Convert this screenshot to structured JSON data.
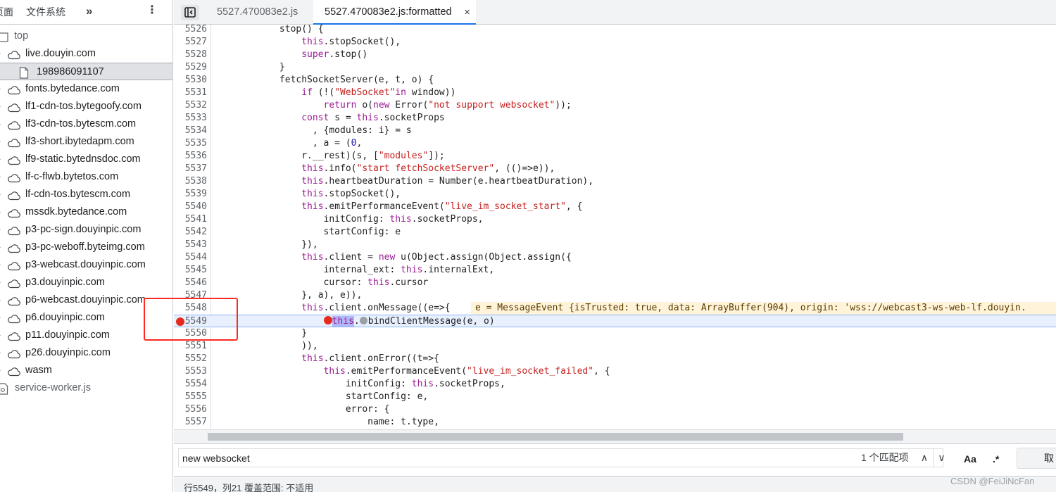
{
  "left_panel": {
    "tabs": {
      "page": "页面",
      "filesystem": "文件系统",
      "more": "»",
      "menu": "⋮"
    },
    "tree": [
      {
        "label": "top",
        "icon": "frame-icon",
        "kind": "frame"
      },
      {
        "label": "live.douyin.com",
        "icon": "cloud-icon",
        "kind": "domain"
      },
      {
        "label": "198986091107",
        "icon": "file-icon",
        "kind": "file",
        "selected": true
      },
      {
        "label": "fonts.bytedance.com",
        "icon": "cloud-icon",
        "kind": "domain"
      },
      {
        "label": "lf1-cdn-tos.bytegoofy.com",
        "icon": "cloud-icon",
        "kind": "domain"
      },
      {
        "label": "lf3-cdn-tos.bytescm.com",
        "icon": "cloud-icon",
        "kind": "domain"
      },
      {
        "label": "lf3-short.ibytedapm.com",
        "icon": "cloud-icon",
        "kind": "domain"
      },
      {
        "label": "lf9-static.bytednsdoc.com",
        "icon": "cloud-icon",
        "kind": "domain"
      },
      {
        "label": "lf-c-flwb.bytetos.com",
        "icon": "cloud-icon",
        "kind": "domain"
      },
      {
        "label": "lf-cdn-tos.bytescm.com",
        "icon": "cloud-icon",
        "kind": "domain"
      },
      {
        "label": "mssdk.bytedance.com",
        "icon": "cloud-icon",
        "kind": "domain"
      },
      {
        "label": "p3-pc-sign.douyinpic.com",
        "icon": "cloud-icon",
        "kind": "domain"
      },
      {
        "label": "p3-pc-weboff.byteimg.com",
        "icon": "cloud-icon",
        "kind": "domain"
      },
      {
        "label": "p3-webcast.douyinpic.com",
        "icon": "cloud-icon",
        "kind": "domain"
      },
      {
        "label": "p3.douyinpic.com",
        "icon": "cloud-icon",
        "kind": "domain"
      },
      {
        "label": "p6-webcast.douyinpic.com",
        "icon": "cloud-icon",
        "kind": "domain"
      },
      {
        "label": "p6.douyinpic.com",
        "icon": "cloud-icon",
        "kind": "domain"
      },
      {
        "label": "p11.douyinpic.com",
        "icon": "cloud-icon",
        "kind": "domain"
      },
      {
        "label": "p26.douyinpic.com",
        "icon": "cloud-icon",
        "kind": "domain"
      },
      {
        "label": "wasm",
        "icon": "cloud-icon",
        "kind": "domain"
      },
      {
        "label": "service-worker.js",
        "icon": "gear-file-icon",
        "kind": "worker"
      }
    ]
  },
  "editor": {
    "tabs": [
      {
        "label": "5527.470083e2.js",
        "active": false
      },
      {
        "label": "5527.470083e2.js:formatted",
        "active": true,
        "close": "×"
      }
    ],
    "lines": [
      {
        "n": "5526",
        "html": "            stop() {"
      },
      {
        "n": "5527",
        "html": "                <span class=\"kw\">this</span>.stopSocket(),"
      },
      {
        "n": "5528",
        "html": "                <span class=\"kw\">super</span>.stop()"
      },
      {
        "n": "5529",
        "html": "            }"
      },
      {
        "n": "5530",
        "html": "            fetchSocketServer(e, t, o) {"
      },
      {
        "n": "5531",
        "html": "                <span class=\"kw\">if</span> (!(<span class=\"str\">\"WebSocket\"</span><span class=\"kw\">in</span> window))"
      },
      {
        "n": "5532",
        "html": "                    <span class=\"kw\">return</span> o(<span class=\"kw\">new</span> Error(<span class=\"str\">\"not support websocket\"</span>));"
      },
      {
        "n": "5533",
        "html": "                <span class=\"kw\">const</span> s = <span class=\"kw\">this</span>.socketProps"
      },
      {
        "n": "5534",
        "html": "                  , {modules: i} = s"
      },
      {
        "n": "5535",
        "html": "                  , a = (<span class=\"num\">0</span>,"
      },
      {
        "n": "5536",
        "html": "                r.__rest)(s, [<span class=\"str\">\"modules\"</span>]);"
      },
      {
        "n": "5537",
        "html": "                <span class=\"kw\">this</span>.info(<span class=\"str\">\"start fetchSocketServer\"</span>, (()=&gt;e)),"
      },
      {
        "n": "5538",
        "html": "                <span class=\"kw\">this</span>.heartbeatDuration = Number(e.heartbeatDuration),"
      },
      {
        "n": "5539",
        "html": "                <span class=\"kw\">this</span>.stopSocket(),"
      },
      {
        "n": "5540",
        "html": "                <span class=\"kw\">this</span>.emitPerformanceEvent(<span class=\"str\">\"live_im_socket_start\"</span>, {"
      },
      {
        "n": "5541",
        "html": "                    initConfig: <span class=\"kw\">this</span>.socketProps,"
      },
      {
        "n": "5542",
        "html": "                    startConfig: e"
      },
      {
        "n": "5543",
        "html": "                }),"
      },
      {
        "n": "5544",
        "html": "                <span class=\"kw\">this</span>.client = <span class=\"kw\">new</span> u(Object.assign(Object.assign({"
      },
      {
        "n": "5545",
        "html": "                    internal_ext: <span class=\"kw\">this</span>.internalExt,"
      },
      {
        "n": "5546",
        "html": "                    cursor: <span class=\"kw\">this</span>.cursor"
      },
      {
        "n": "5547",
        "html": "                }, a), e)),"
      },
      {
        "n": "5548",
        "html": "                <span class=\"kw\">this</span>.client.onMessage((e=&gt;{",
        "inline": "e = MessageEvent {isTrusted: true, data: ArrayBuffer(904), origin: 'wss://webcast3-ws-web-lf.douyin."
      },
      {
        "n": "5549",
        "html": "                    <span class=\"bp-dot\"></span><span class=\"kw hl\">this</span>.<span class=\"gray-dot\"></span>bindClientMessage(e, o)",
        "paused": true,
        "breakpoint": true
      },
      {
        "n": "5550",
        "html": "                }"
      },
      {
        "n": "5551",
        "html": "                )),"
      },
      {
        "n": "5552",
        "html": "                <span class=\"kw\">this</span>.client.onError((t=&gt;{"
      },
      {
        "n": "5553",
        "html": "                    <span class=\"kw\">this</span>.emitPerformanceEvent(<span class=\"str\">\"live_im_socket_failed\"</span>, {"
      },
      {
        "n": "5554",
        "html": "                        initConfig: <span class=\"kw\">this</span>.socketProps,"
      },
      {
        "n": "5555",
        "html": "                        startConfig: e,"
      },
      {
        "n": "5556",
        "html": "                        error: {"
      },
      {
        "n": "5557",
        "html": "                            name: t.type,"
      }
    ]
  },
  "search": {
    "value": "new websocket",
    "match_count": "1 个匹配项",
    "prev": "∧",
    "next": "∨",
    "match_case": "Aa",
    "regex": ".*",
    "cancel": "取消"
  },
  "status": {
    "text": "行5549，列21    覆盖范围: 不适用"
  },
  "watermark": "CSDN @FeiJiNcFan",
  "colors": {
    "breakpoint": "#e52b1c",
    "annotation": "#ff2a1f",
    "paused_line": "#e8f0fe",
    "accent": "#1a73e8"
  }
}
